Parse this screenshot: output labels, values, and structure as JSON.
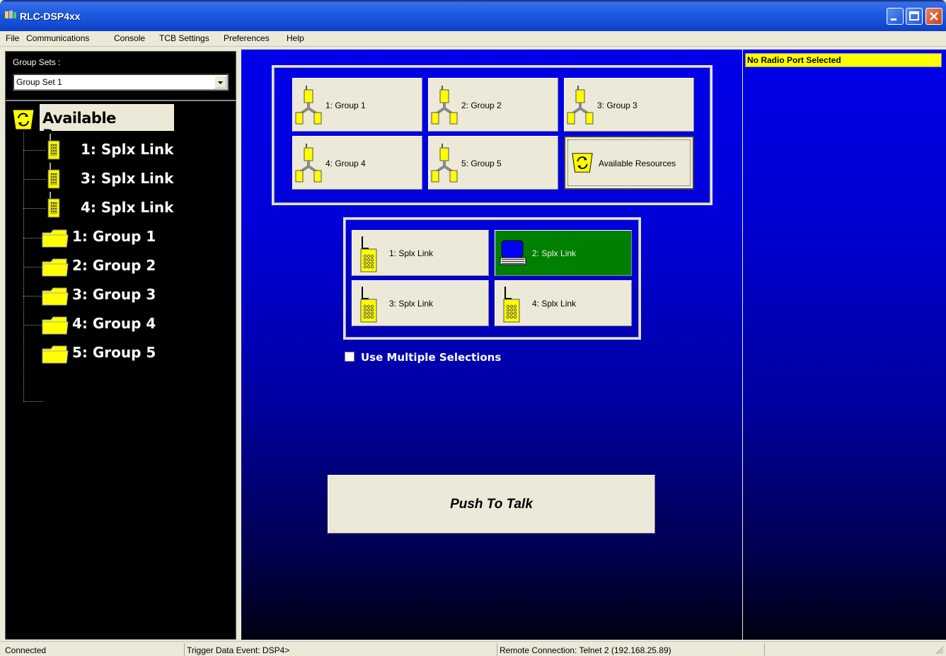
{
  "window": {
    "title": "RLC-DSP4xx"
  },
  "menu": [
    "File",
    "Communications",
    "Console",
    "TCB Settings",
    "Preferences",
    "Help"
  ],
  "left": {
    "group_sets_label": "Group Sets :",
    "group_set_selected": "Group Set 1",
    "tree": {
      "root": "Available Resources",
      "items": [
        {
          "label": "1: Splx Link",
          "type": "radio"
        },
        {
          "label": "3: Splx Link",
          "type": "radio"
        },
        {
          "label": "4: Splx Link",
          "type": "radio"
        },
        {
          "label": "1: Group 1",
          "type": "folder"
        },
        {
          "label": "2: Group 2",
          "type": "folder"
        },
        {
          "label": "3: Group 3",
          "type": "folder"
        },
        {
          "label": "4: Group 4",
          "type": "folder"
        },
        {
          "label": "5: Group 5",
          "type": "folder"
        }
      ]
    }
  },
  "groups": [
    {
      "label": "1: Group 1"
    },
    {
      "label": "2: Group 2"
    },
    {
      "label": "3: Group 3"
    },
    {
      "label": "4: Group 4"
    },
    {
      "label": "5: Group 5"
    },
    {
      "label": "Available Resources"
    }
  ],
  "resources": [
    {
      "label": "1: Splx Link",
      "active": false
    },
    {
      "label": "2: Splx Link",
      "active": true
    },
    {
      "label": "3: Splx Link",
      "active": false
    },
    {
      "label": "4: Splx Link",
      "active": false
    }
  ],
  "multi_select_label": "Use Multiple Selections",
  "ptt_label": "Push To Talk",
  "right": {
    "radio_status": "No Radio Port Selected"
  },
  "status": {
    "connection": "Connected",
    "trigger": "Trigger Data Event: DSP4>",
    "remote": "Remote Connection: Telnet 2 (192.168.25.89)"
  },
  "colors": {
    "active_resource": "#008000",
    "status_highlight": "#ffff00",
    "panel_blue": "#0000e8"
  }
}
